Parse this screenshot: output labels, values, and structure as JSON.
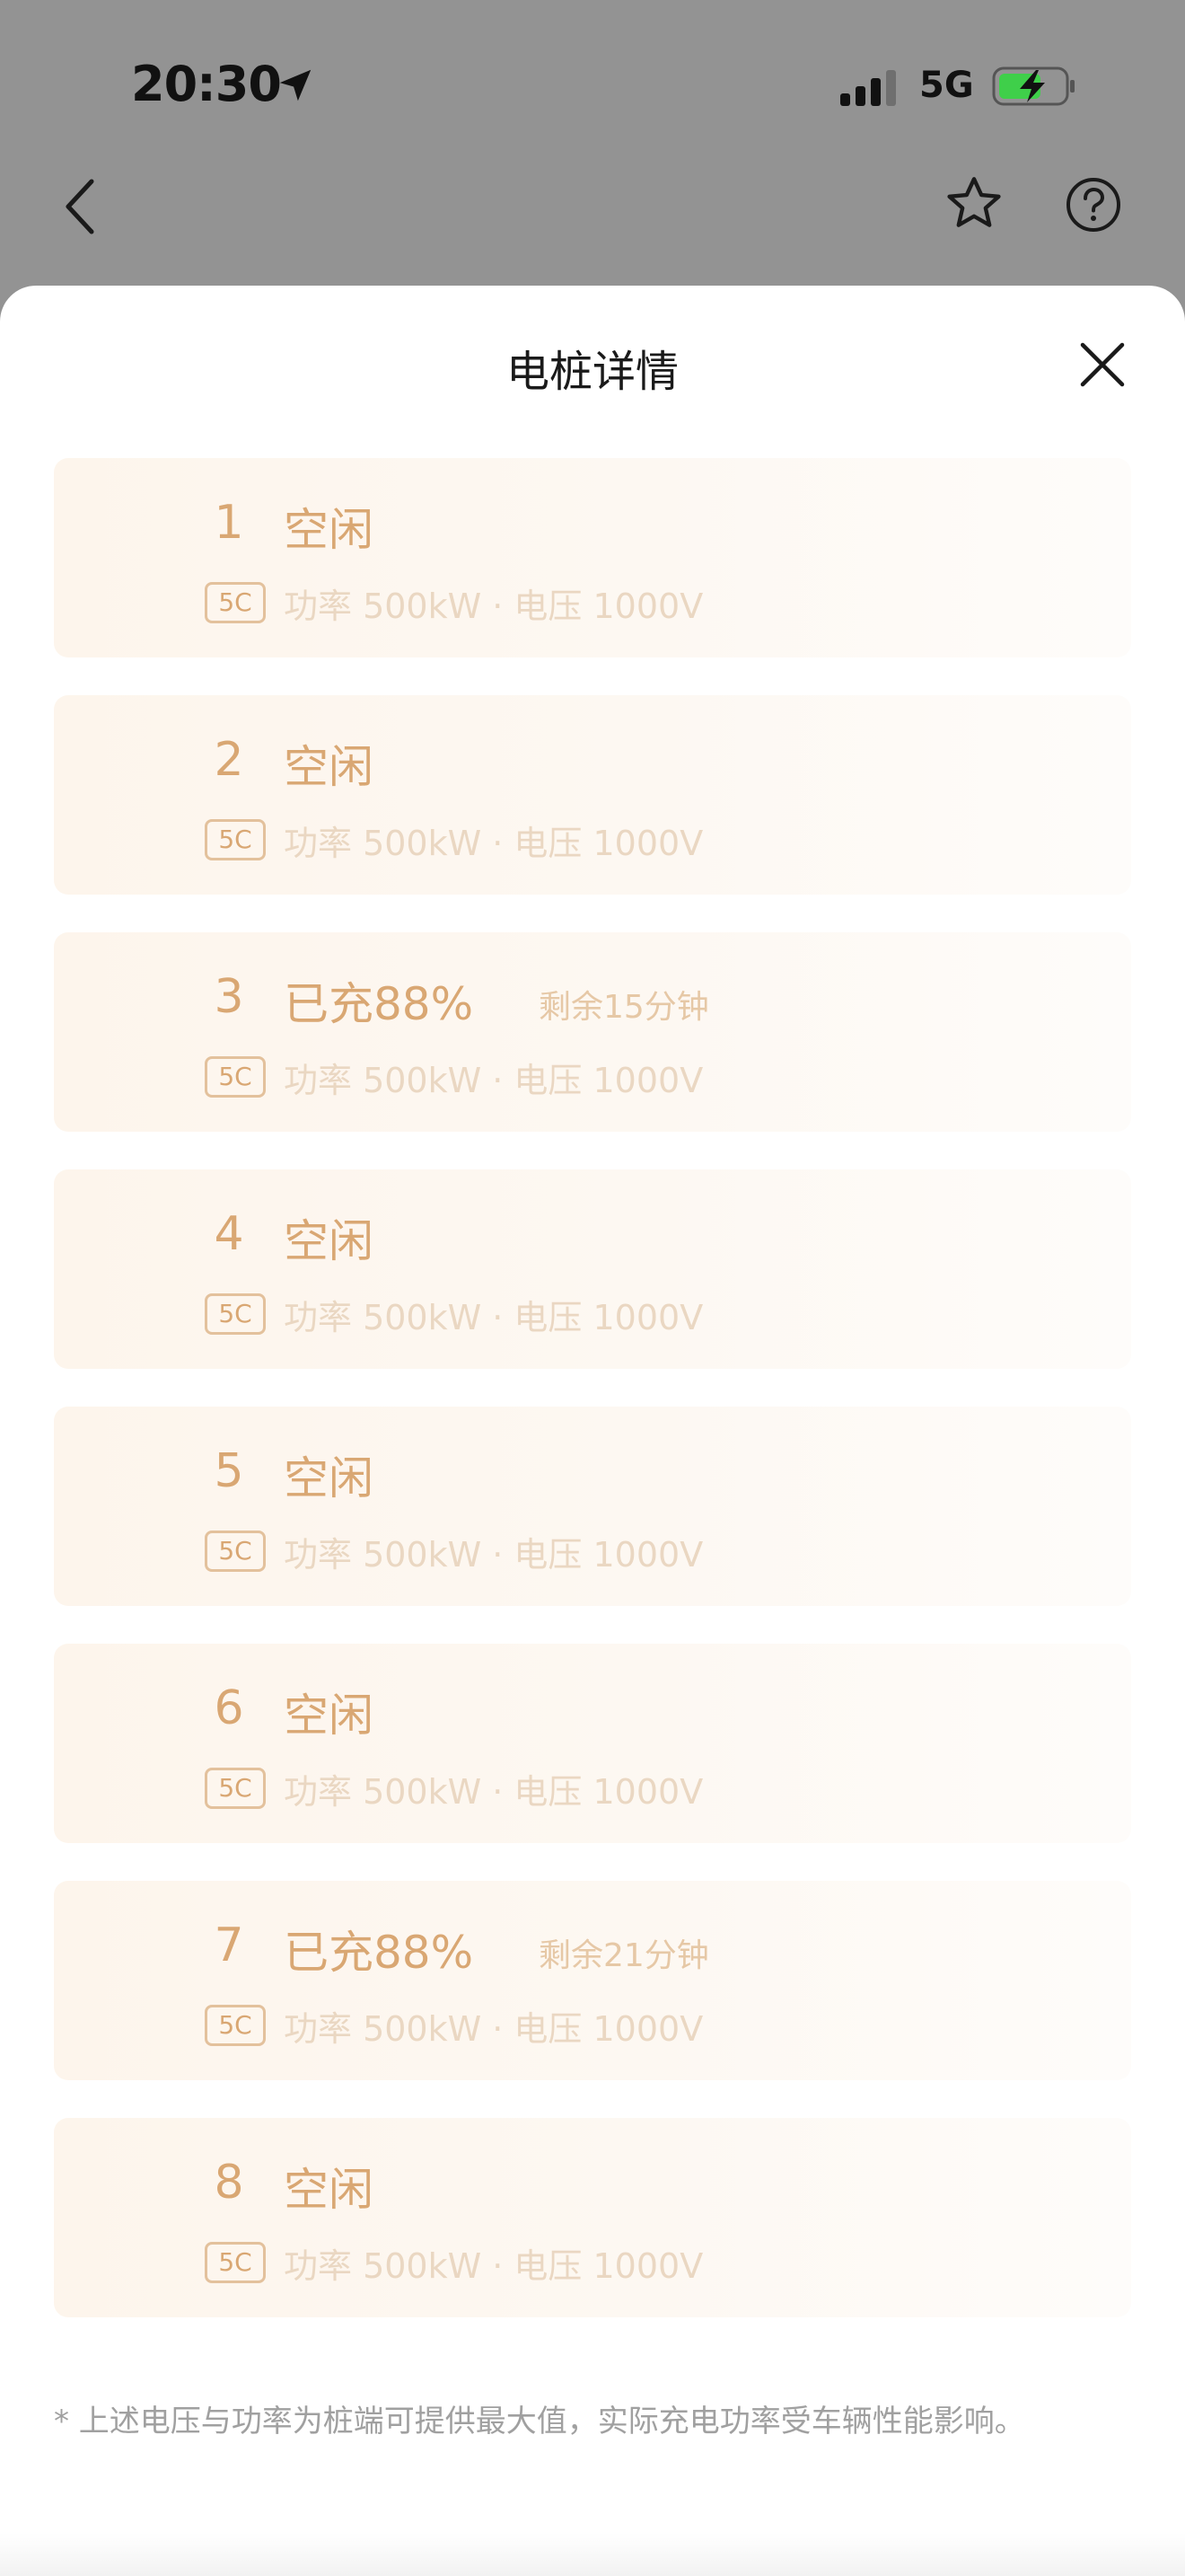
{
  "status_bar": {
    "time": "20:30",
    "network": "5G",
    "battery_color": "#3fcf4a",
    "location_icon": "location-arrow-icon",
    "signal_icon": "signal-bars-icon",
    "battery_icon": "battery-charging-icon"
  },
  "nav": {
    "back_icon": "chevron-left-icon",
    "star_icon": "star-outline-icon",
    "help_icon": "question-circle-icon"
  },
  "sheet": {
    "title": "电桩详情",
    "close_icon": "close-icon",
    "piles": [
      {
        "num": "1",
        "status": "空闲",
        "remaining": "",
        "badge": "5C",
        "spec": "功率 500kW · 电压 1000V"
      },
      {
        "num": "2",
        "status": "空闲",
        "remaining": "",
        "badge": "5C",
        "spec": "功率 500kW · 电压 1000V"
      },
      {
        "num": "3",
        "status": "已充88%",
        "remaining": "剩余15分钟",
        "badge": "5C",
        "spec": "功率 500kW · 电压 1000V"
      },
      {
        "num": "4",
        "status": "空闲",
        "remaining": "",
        "badge": "5C",
        "spec": "功率 500kW · 电压 1000V"
      },
      {
        "num": "5",
        "status": "空闲",
        "remaining": "",
        "badge": "5C",
        "spec": "功率 500kW · 电压 1000V"
      },
      {
        "num": "6",
        "status": "空闲",
        "remaining": "",
        "badge": "5C",
        "spec": "功率 500kW · 电压 1000V"
      },
      {
        "num": "7",
        "status": "已充88%",
        "remaining": "剩余21分钟",
        "badge": "5C",
        "spec": "功率 500kW · 电压 1000V"
      },
      {
        "num": "8",
        "status": "空闲",
        "remaining": "",
        "badge": "5C",
        "spec": "功率 500kW · 电压 1000V"
      }
    ],
    "footnote": "* 上述电压与功率为桩端可提供最大值，实际充电功率受车辆性能影响。"
  },
  "colors": {
    "accent": "#d9a773",
    "accent_light": "#ead7c2",
    "overlay": "#939393",
    "card_bg": "#fdf5ec"
  }
}
